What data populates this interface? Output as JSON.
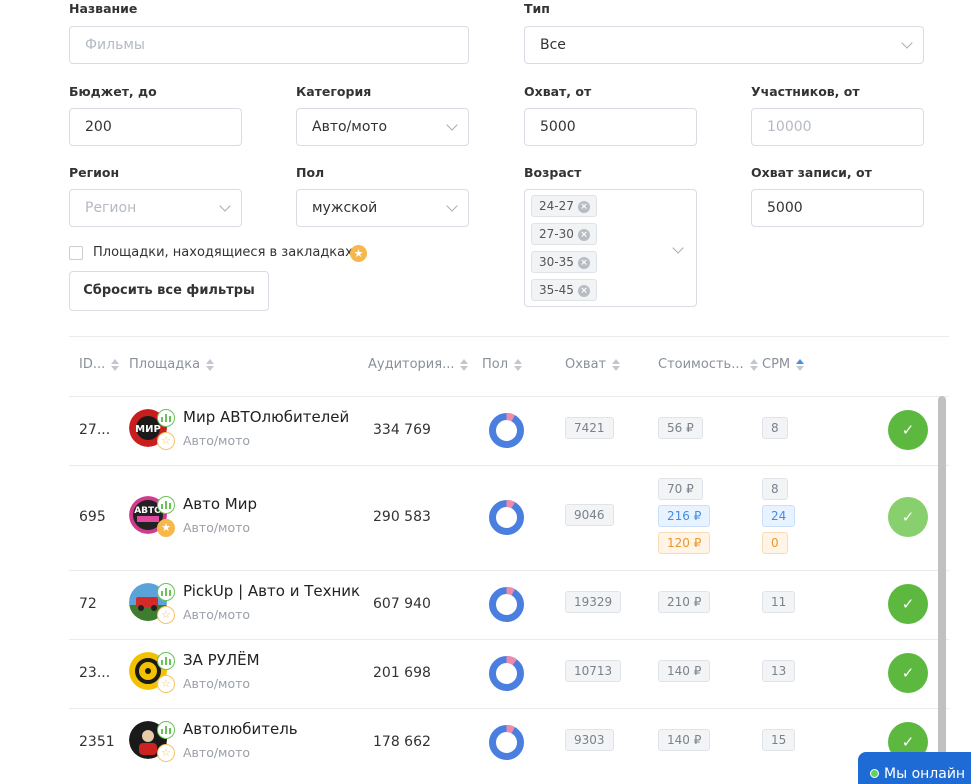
{
  "filters": {
    "name_label": "Название",
    "name_placeholder": "Фильмы",
    "type_label": "Тип",
    "type_value": "Все",
    "budget_label": "Бюджет, до",
    "budget_value": "200",
    "category_label": "Категория",
    "category_value": "Авто/мото",
    "reach_label": "Охват, от",
    "reach_value": "5000",
    "members_label": "Участников, от",
    "members_placeholder": "10000",
    "region_label": "Регион",
    "region_placeholder": "Регион",
    "gender_label": "Пол",
    "gender_value": "мужской",
    "age_label": "Возраст",
    "age_tags": [
      "24-27",
      "27-30",
      "30-35",
      "35-45"
    ],
    "post_reach_label": "Охват записи, от",
    "post_reach_value": "5000",
    "bookmarks_label": "Площадки, находящиеся в закладках",
    "reset_label": "Сбросить все фильтры"
  },
  "table": {
    "headers": {
      "id": "ID...",
      "platform": "Площадка",
      "audience": "Аудитория...",
      "gender": "Пол",
      "reach": "Охват",
      "cost": "Стоимость...",
      "cpm": "CPM"
    },
    "rows": [
      {
        "id": "27...",
        "name": "Мир АВТОлюбителей",
        "category": "Авто/мото",
        "audience": "334 769",
        "reach": "7421",
        "costs": [
          "56 ₽"
        ],
        "cpms": [
          "8"
        ],
        "fav": false,
        "female_share": 0.08
      },
      {
        "id": "695",
        "name": "Авто Мир",
        "category": "Авто/мото",
        "audience": "290 583",
        "reach": "9046",
        "costs": [
          "70 ₽",
          "216 ₽",
          "120 ₽"
        ],
        "cpms": [
          "8",
          "24",
          "0"
        ],
        "fav": true,
        "female_share": 0.08
      },
      {
        "id": "72",
        "name": "PickUp | Авто и Техник",
        "category": "Авто/мото",
        "audience": "607 940",
        "reach": "19329",
        "costs": [
          "210 ₽"
        ],
        "cpms": [
          "11"
        ],
        "fav": false,
        "female_share": 0.08
      },
      {
        "id": "23...",
        "name": "ЗА РУЛЁМ",
        "category": "Авто/мото",
        "audience": "201 698",
        "reach": "10713",
        "costs": [
          "140 ₽"
        ],
        "cpms": [
          "13"
        ],
        "fav": false,
        "female_share": 0.1
      },
      {
        "id": "2351",
        "name": "Автолюбитель",
        "category": "Авто/мото",
        "audience": "178 662",
        "reach": "9303",
        "costs": [
          "140 ₽"
        ],
        "cpms": [
          "15"
        ],
        "fav": false,
        "female_share": 0.08
      }
    ]
  },
  "avatar_text": {
    "row0": "МИР",
    "row1": "АВТО"
  },
  "chat_label": "Мы онлайн",
  "colors": {
    "accent_green": "#5cb83f",
    "male_blue": "#4a7fe0",
    "female_pink": "#f08aa8",
    "chat_blue": "#1e6bd6"
  }
}
